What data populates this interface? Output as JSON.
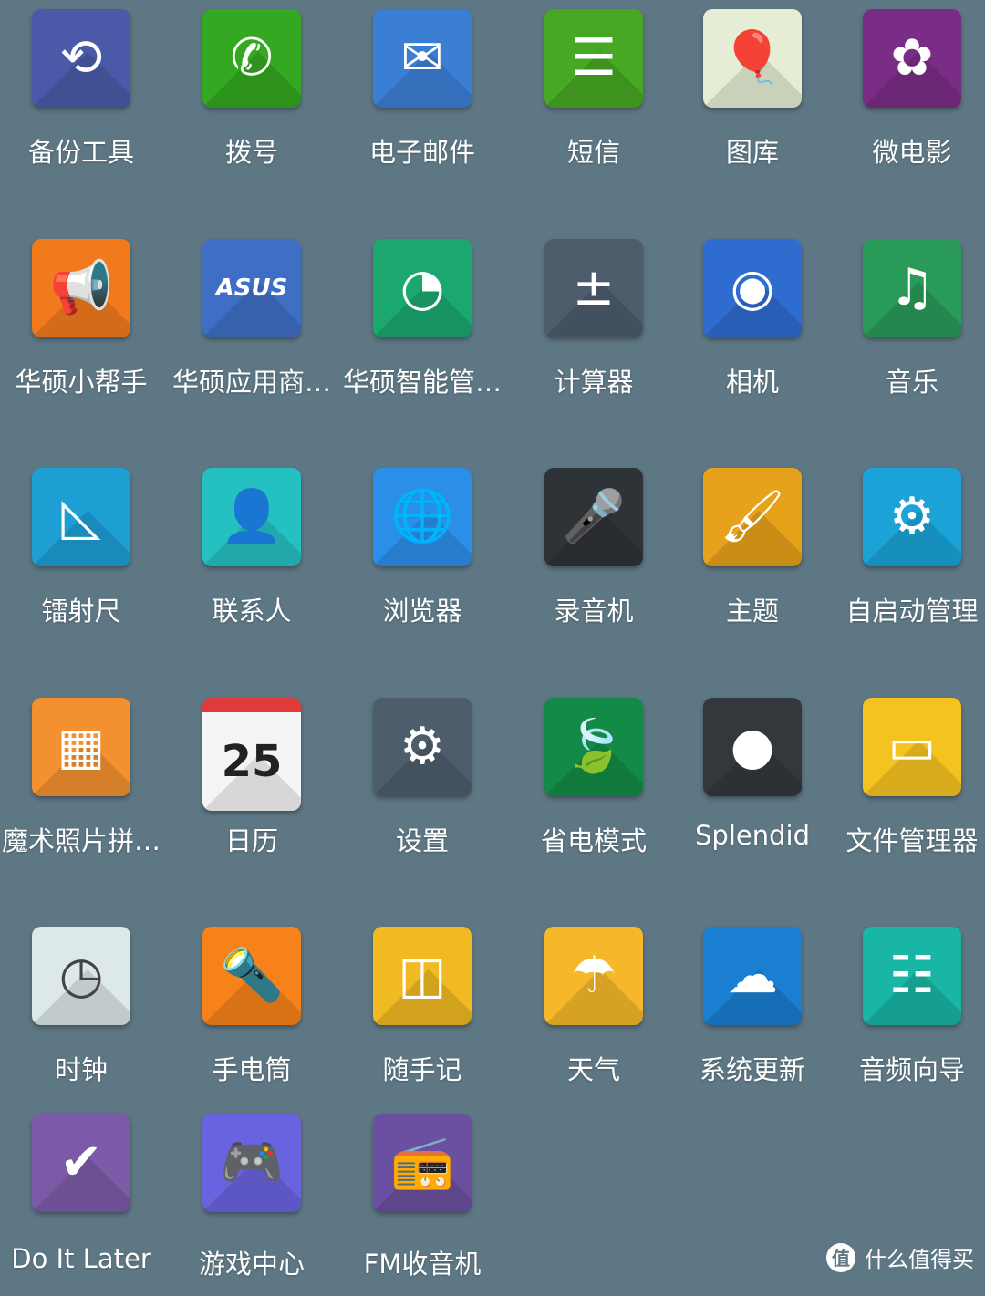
{
  "background_color": "#5e7784",
  "apps": [
    {
      "label": "备份工具",
      "icon": "backup-icon",
      "color": "#4a5aa8",
      "glyph": "⟲"
    },
    {
      "label": "拨号",
      "icon": "phone-icon",
      "color": "#34a821",
      "glyph": "✆"
    },
    {
      "label": "电子邮件",
      "icon": "mail-icon",
      "color": "#3b7fd4",
      "glyph": "✉"
    },
    {
      "label": "短信",
      "icon": "message-icon",
      "color": "#47a823",
      "glyph": "☰"
    },
    {
      "label": "图库",
      "icon": "gallery-balloon-icon",
      "color": "#e5eed5",
      "glyph": "🎈"
    },
    {
      "label": "微电影",
      "icon": "movie-icon",
      "color": "#7a2d86",
      "glyph": "✿"
    },
    {
      "label": "华硕小帮手",
      "icon": "megaphone-icon",
      "color": "#f17a1c",
      "glyph": "📢"
    },
    {
      "label": "华硕应用商…",
      "icon": "asus-store-icon",
      "color": "#3f6fc4",
      "glyph": "ASUS"
    },
    {
      "label": "华硕智能管…",
      "icon": "gauge-icon",
      "color": "#1aa86e",
      "glyph": "◔"
    },
    {
      "label": "计算器",
      "icon": "calculator-icon",
      "color": "#4d5d6c",
      "glyph": "±"
    },
    {
      "label": "相机",
      "icon": "camera-icon",
      "color": "#2f6cd0",
      "glyph": "◉"
    },
    {
      "label": "音乐",
      "icon": "music-icon",
      "color": "#2a9a58",
      "glyph": "♫"
    },
    {
      "label": "镭射尺",
      "icon": "ruler-icon",
      "color": "#1d9fd4",
      "glyph": "◺"
    },
    {
      "label": "联系人",
      "icon": "contacts-icon",
      "color": "#25c1c0",
      "glyph": "👤"
    },
    {
      "label": "浏览器",
      "icon": "globe-icon",
      "color": "#2b8fe8",
      "glyph": "🌐"
    },
    {
      "label": "录音机",
      "icon": "microphone-icon",
      "color": "#2e3338",
      "glyph": "🎤"
    },
    {
      "label": "主题",
      "icon": "paint-roller-icon",
      "color": "#e6a21a",
      "glyph": "🖌"
    },
    {
      "label": "自启动管理",
      "icon": "auto-start-icon",
      "color": "#1ba3d8",
      "glyph": "⚙"
    },
    {
      "label": "魔术照片拼…",
      "icon": "collage-icon",
      "color": "#f39130",
      "glyph": "▦"
    },
    {
      "label": "日历",
      "icon": "calendar-icon",
      "color": "#f5f5f5",
      "glyph": "25"
    },
    {
      "label": "设置",
      "icon": "gear-icon",
      "color": "#4e5d6b",
      "glyph": "⚙"
    },
    {
      "label": "省电模式",
      "icon": "leaf-icon",
      "color": "#138a45",
      "glyph": "🍃"
    },
    {
      "label": "Splendid",
      "icon": "splendid-icon",
      "color": "#33383d",
      "glyph": "●"
    },
    {
      "label": "文件管理器",
      "icon": "folder-icon",
      "color": "#f5c320",
      "glyph": "▭"
    },
    {
      "label": "时钟",
      "icon": "clock-icon",
      "color": "#dde8e8",
      "glyph": "◷"
    },
    {
      "label": "手电筒",
      "icon": "flashlight-icon",
      "color": "#f7821a",
      "glyph": "🔦"
    },
    {
      "label": "随手记",
      "icon": "note-icon",
      "color": "#f1b922",
      "glyph": "◫"
    },
    {
      "label": "天气",
      "icon": "umbrella-icon",
      "color": "#f5b82a",
      "glyph": "☂"
    },
    {
      "label": "系统更新",
      "icon": "cloud-download-icon",
      "color": "#1a7fd0",
      "glyph": "☁"
    },
    {
      "label": "音频向导",
      "icon": "audio-wizard-icon",
      "color": "#19b5a5",
      "glyph": "☷"
    },
    {
      "label": "Do It Later",
      "icon": "check-icon",
      "color": "#7d5aa8",
      "glyph": "✔"
    },
    {
      "label": "游戏中心",
      "icon": "gamepad-icon",
      "color": "#6a63e0",
      "glyph": "🎮"
    },
    {
      "label": "FM收音机",
      "icon": "radio-icon",
      "color": "#6b4fa0",
      "glyph": "📻"
    }
  ],
  "watermark": {
    "icon_text": "值",
    "text": "什么值得买"
  }
}
